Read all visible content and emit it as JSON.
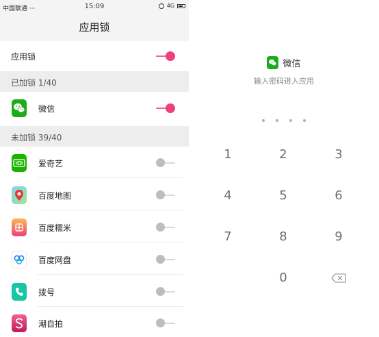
{
  "status_bar": {
    "carrier": "中国联通 ···",
    "time": "15:09",
    "network": "4G"
  },
  "header": {
    "title": "应用锁"
  },
  "master": {
    "label": "应用锁",
    "enabled": true
  },
  "locked_section": {
    "header": "已加锁 1/40",
    "apps": [
      {
        "name": "微信",
        "icon": "wechat-icon",
        "locked": true
      }
    ]
  },
  "unlocked_section": {
    "header": "未加锁 39/40",
    "apps": [
      {
        "name": "爱奇艺",
        "icon": "iqiyi-icon",
        "locked": false
      },
      {
        "name": "百度地图",
        "icon": "baidu-map-icon",
        "locked": false
      },
      {
        "name": "百度糯米",
        "icon": "baidu-nuomi-icon",
        "locked": false
      },
      {
        "name": "百度网盘",
        "icon": "baidu-netdisk-icon",
        "locked": false
      },
      {
        "name": "拨号",
        "icon": "phone-dialer-icon",
        "locked": false
      },
      {
        "name": "潮自拍",
        "icon": "selfie-app-icon",
        "locked": false
      }
    ]
  },
  "lock_screen": {
    "app_name": "微信",
    "hint": "输入密码进入应用",
    "pin_length": 4,
    "keys": [
      "1",
      "2",
      "3",
      "4",
      "5",
      "6",
      "7",
      "8",
      "9",
      "0"
    ]
  },
  "colors": {
    "accent_pink": "#ee3f7e",
    "wechat_green": "#1aad19",
    "section_bg": "#ededed"
  }
}
